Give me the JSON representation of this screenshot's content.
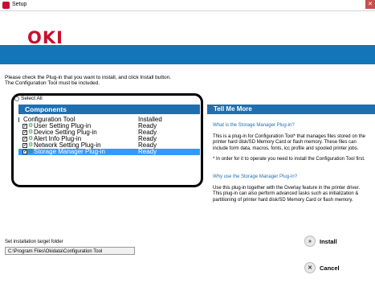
{
  "window": {
    "title": "Setup",
    "close_label": "✕"
  },
  "header": {
    "logo": "OKI",
    "accent_color": "#1475b8",
    "logo_color": "#c8102e"
  },
  "intro": {
    "line1": "Please check the Plug-in that you want to install, and click Install button.",
    "line2": "The Configuration Tool must be included."
  },
  "select_all": "Select All",
  "components": {
    "header": "Components",
    "rows": [
      {
        "name": "Configuration Tool",
        "status": "Installed"
      },
      {
        "name": "User Setting Plug-in",
        "status": "Ready"
      },
      {
        "name": "Device Setting Plug-in",
        "status": "Ready"
      },
      {
        "name": "Alert Info Plug-in",
        "status": "Ready"
      },
      {
        "name": "Network Setting Plug-in",
        "status": "Ready"
      },
      {
        "name": "Storage Manager Plug-in",
        "status": "Ready"
      }
    ]
  },
  "tell_more": {
    "header": "Tell Me More",
    "q1": "What is the Storage Manager Plug-in?",
    "p1": "This is a plug-in for Configuration Tool* that manages files stored on the printer hard disk/SD Memory Card or flash memory. These files can include form data, macros, fonts, icc profile and spooled printer jobs.",
    "p2": "* In order for it to operate you need to install the Configuration Tool first.",
    "q2": "Why use the Storage Manager Plug-in?",
    "p3": "Use this plug-in together with the Overlay feature in the printer driver. This plug-in can also perform advanced tasks such as initialization & partitioning of printer hard disk/SD Memory Card or flash memory."
  },
  "target": {
    "label": "Set installation target folder",
    "path": "C:\\Program Files\\Okidata\\Configuration Tool"
  },
  "buttons": {
    "install": "Install",
    "cancel": "Cancel",
    "install_icon": "»",
    "cancel_icon": "✕"
  }
}
